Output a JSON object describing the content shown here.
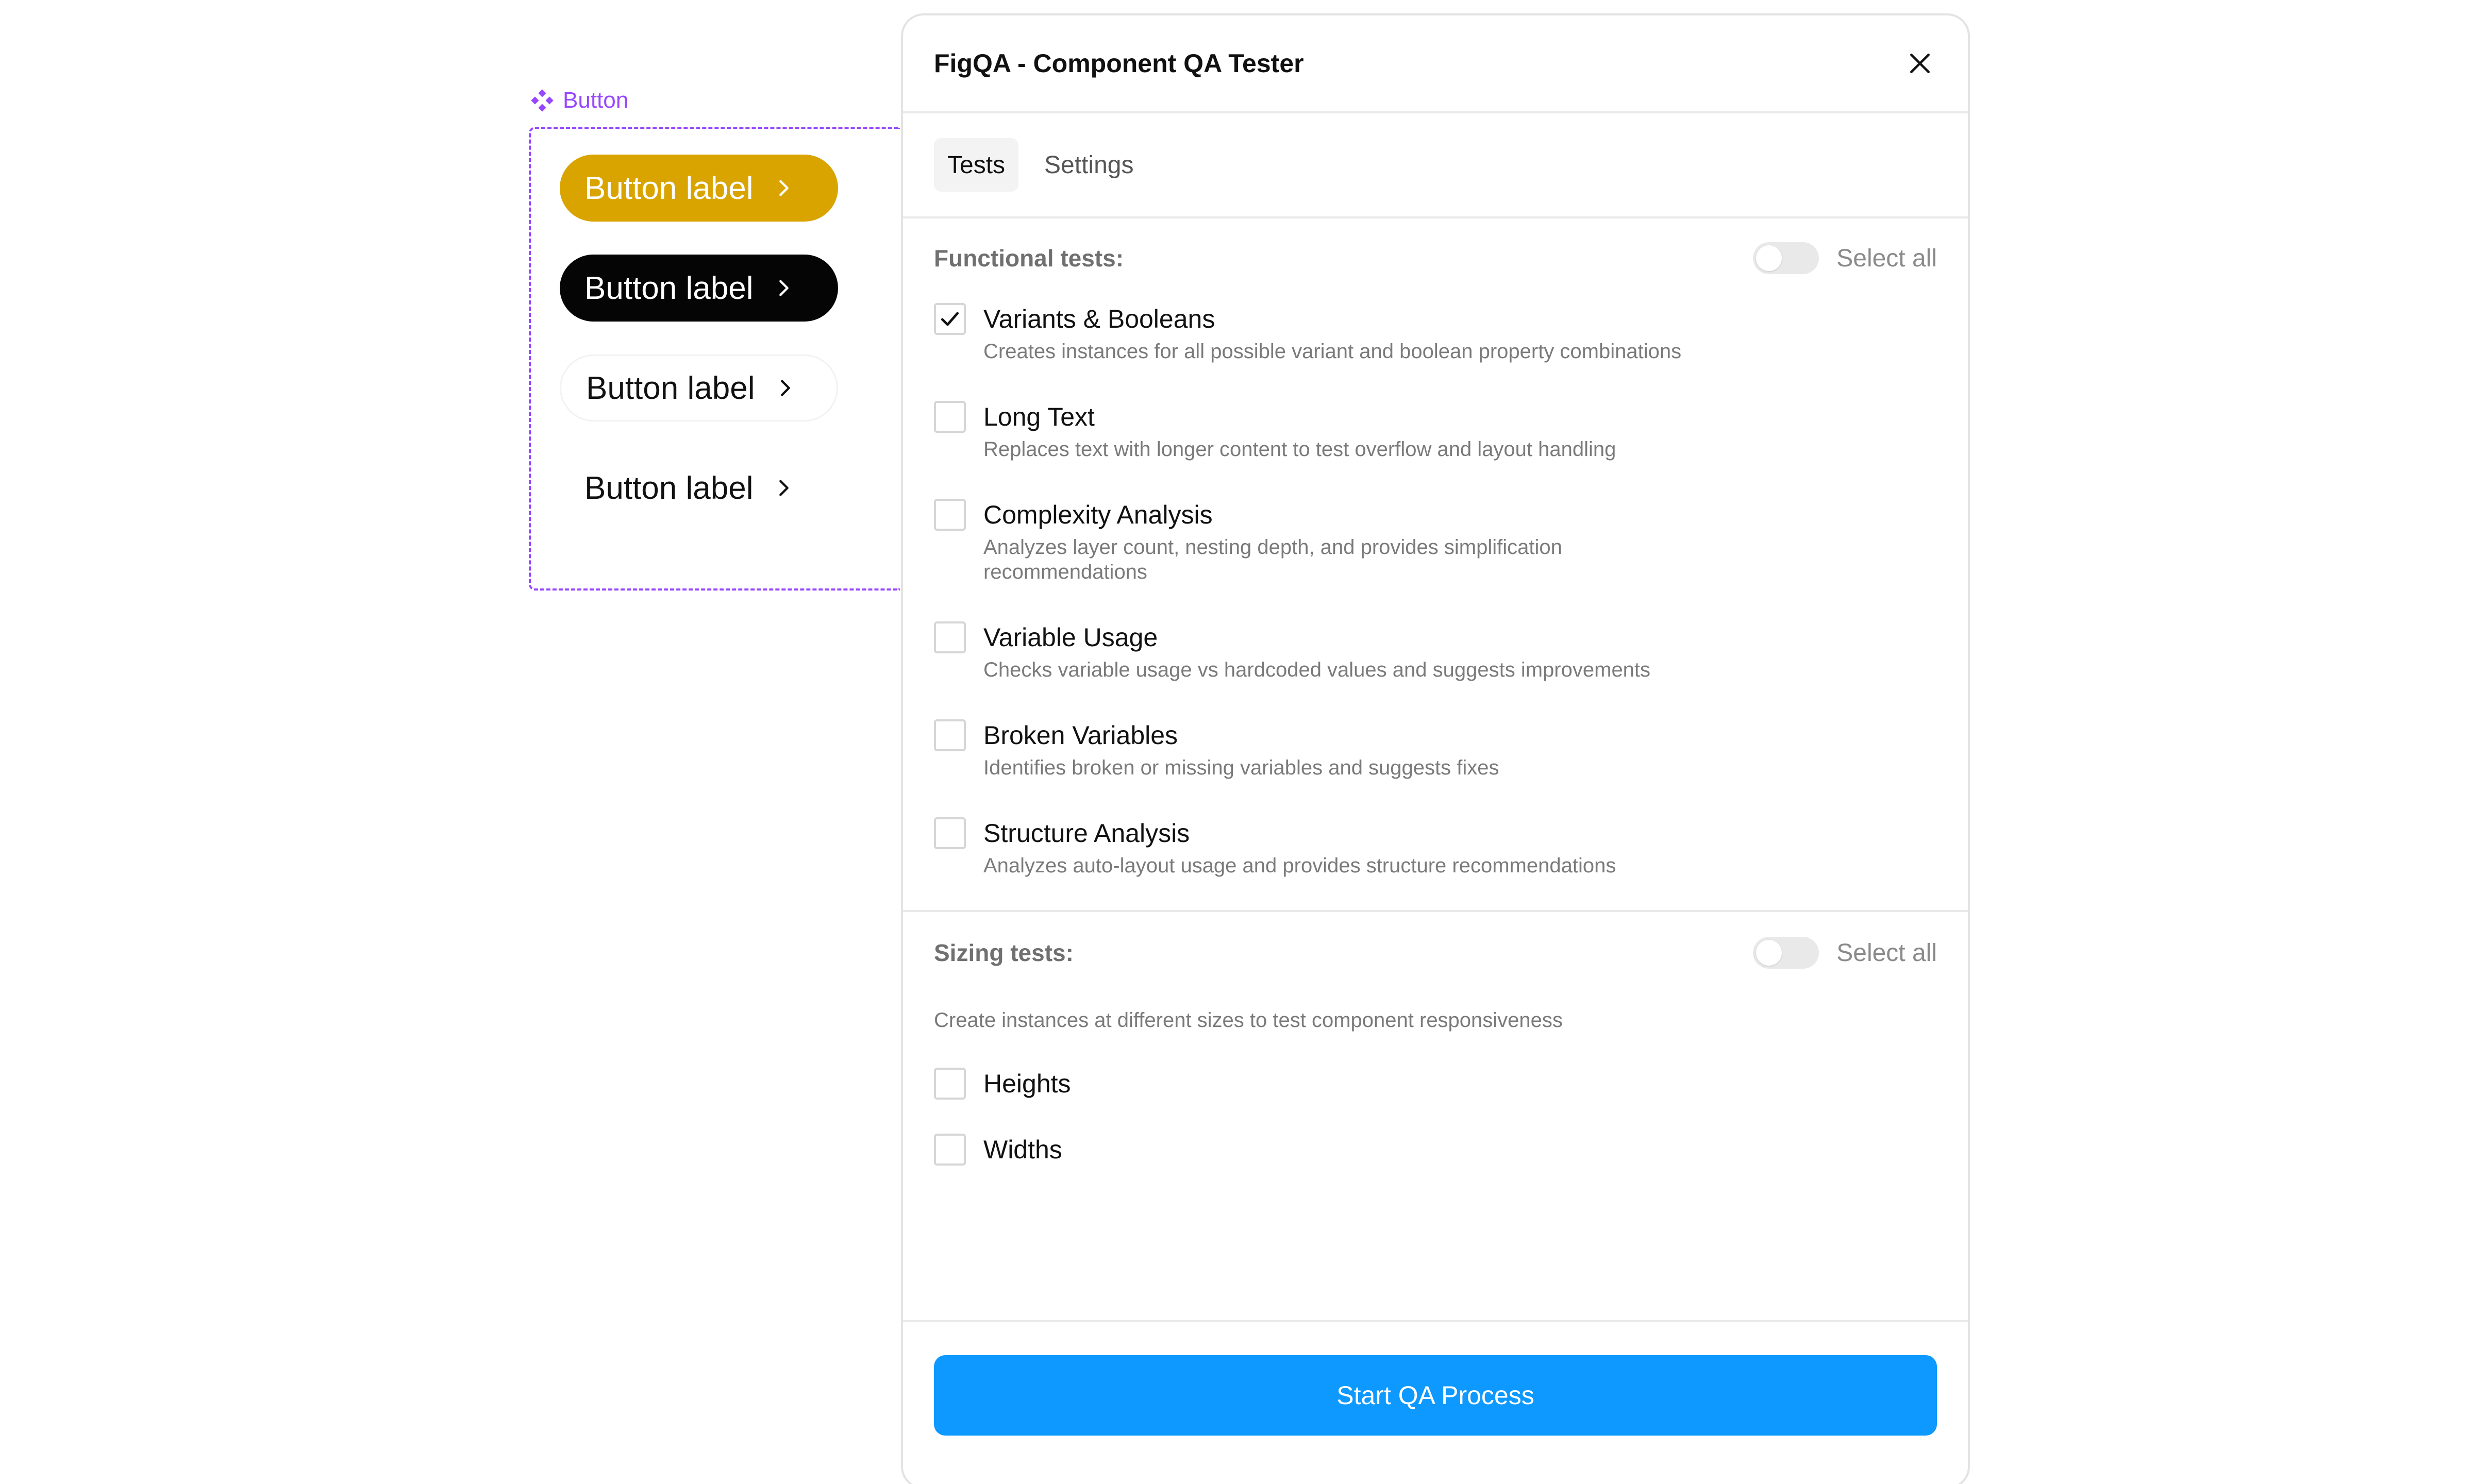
{
  "canvas": {
    "component_name": "Button",
    "variants": [
      {
        "label": "Button label",
        "fill": "#D9A400"
      },
      {
        "label": "Button label",
        "fill": "#050505"
      },
      {
        "label": "Button label",
        "fill": "#FFFFFF"
      },
      {
        "label": "Button label",
        "fill": "transparent"
      }
    ],
    "accent_color": "#9747FF"
  },
  "plugin": {
    "title": "FigQA - Component QA Tester",
    "tabs": [
      {
        "label": "Tests",
        "active": true
      },
      {
        "label": "Settings",
        "active": false
      }
    ],
    "functional": {
      "title": "Functional tests:",
      "select_all_label": "Select all",
      "select_all_on": false,
      "tests": [
        {
          "name": "Variants & Booleans",
          "description": "Creates instances for all possible variant and boolean property combinations",
          "checked": true
        },
        {
          "name": "Long Text",
          "description": "Replaces text with longer content to test overflow and layout handling",
          "checked": false
        },
        {
          "name": "Complexity Analysis",
          "description": "Analyzes layer count, nesting depth, and provides simplification recommendations",
          "checked": false
        },
        {
          "name": "Variable Usage",
          "description": "Checks variable usage vs hardcoded values and suggests improvements",
          "checked": false
        },
        {
          "name": "Broken Variables",
          "description": "Identifies broken or missing variables and suggests fixes",
          "checked": false
        },
        {
          "name": "Structure Analysis",
          "description": "Analyzes auto-layout usage and provides structure recommendations",
          "checked": false
        }
      ]
    },
    "sizing": {
      "title": "Sizing tests:",
      "select_all_label": "Select all",
      "select_all_on": false,
      "description": "Create instances at different sizes to test component responsiveness",
      "tests": [
        {
          "name": "Heights",
          "checked": false
        },
        {
          "name": "Widths",
          "checked": false
        }
      ]
    },
    "start_button_label": "Start QA Process",
    "primary_color": "#0D99FF"
  }
}
